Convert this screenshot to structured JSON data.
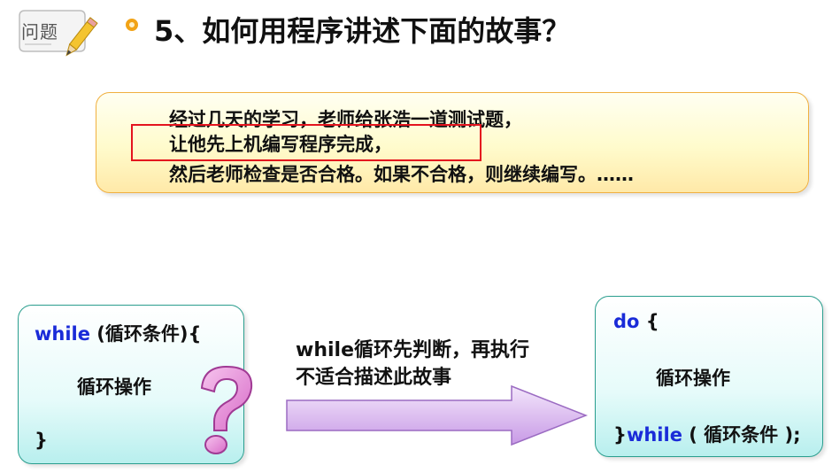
{
  "header": {
    "badge_label": "问题",
    "title": "5、如何用程序讲述下面的故事？"
  },
  "story": {
    "line1": "经过几天的学习，老师给张浩一道测试题，",
    "line2": "让他先上机编写程序完成，",
    "line3": "然后老师检查是否合格。如果不合格，则继续编写。……"
  },
  "while_box": {
    "keyword": "while",
    "condition": " (循环条件){",
    "body": "循环操作",
    "close": "}"
  },
  "message": {
    "line1": "while循环先判断，再执行",
    "line2": "不适合描述此故事"
  },
  "do_box": {
    "keyword": "do",
    "open": " {",
    "body": "循环操作",
    "close": "}",
    "while_keyword": "while",
    "condition": " ( 循环条件 );"
  },
  "colors": {
    "keyword": "#1a2bd8",
    "highlight_border": "#e4141e",
    "bullet": "#f2a316",
    "story_border": "#f0b040",
    "code_border": "#2a9e8e",
    "arrow_fill": "#d9b8ee",
    "question_fill": "#e48ad8"
  },
  "icons": {
    "badge": "pencil-note-icon",
    "question": "question-mark-icon",
    "arrow": "right-arrow-icon"
  }
}
